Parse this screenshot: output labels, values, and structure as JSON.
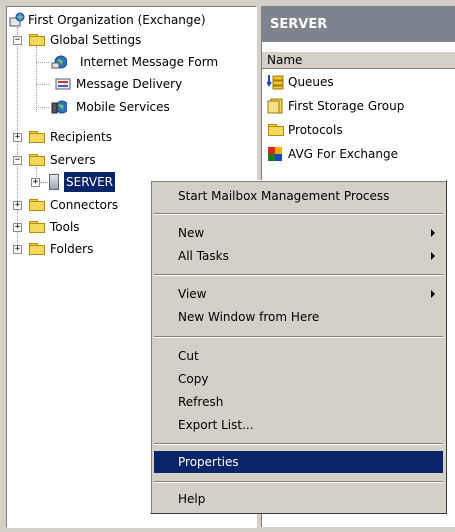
{
  "tree": {
    "root": "First Organization (Exchange)",
    "global_settings": "Global Settings",
    "internet_message_formats": "Internet Message Form",
    "message_delivery": "Message Delivery",
    "mobile_services": "Mobile Services",
    "recipients": "Recipients",
    "servers": "Servers",
    "server": "SERVER",
    "connectors": "Connectors",
    "tools": "Tools",
    "folders": "Folders"
  },
  "right_pane": {
    "title": "SERVER",
    "column_name": "Name",
    "items": [
      "Queues",
      "First Storage Group",
      "Protocols",
      "AVG For Exchange"
    ]
  },
  "context_menu": {
    "start_mailbox_management": "Start Mailbox Management Process",
    "new": "New",
    "all_tasks": "All Tasks",
    "view": "View",
    "new_window": "New Window from Here",
    "cut": "Cut",
    "copy": "Copy",
    "refresh": "Refresh",
    "export_list": "Export List...",
    "properties": "Properties",
    "help": "Help",
    "highlighted": "Properties"
  },
  "colors": {
    "selection": "#0a246a",
    "title_bar": "#7e848e",
    "window_face": "#d4d0c8"
  }
}
